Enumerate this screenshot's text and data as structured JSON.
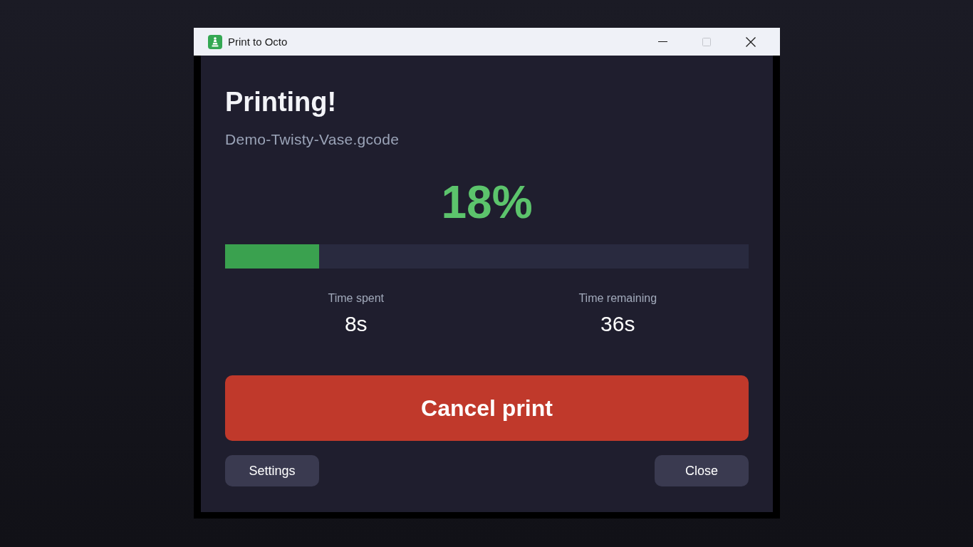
{
  "window": {
    "title": "Print to Octo",
    "controls": [
      {
        "kind": "minimize",
        "disabled": false
      },
      {
        "kind": "maximize",
        "disabled": true
      },
      {
        "kind": "close",
        "disabled": false
      }
    ]
  },
  "status": {
    "heading": "Printing!",
    "filename": "Demo-Twisty-Vase.gcode",
    "percent": "18%"
  },
  "progress": {
    "level": 0.18
  },
  "stats": [
    {
      "label": "Time spent",
      "value": "8s"
    },
    {
      "label": "Time remaining",
      "value": "36s"
    }
  ],
  "primary_button": {
    "label": "Cancel print"
  },
  "buttons": [
    {
      "label": "Settings"
    },
    {
      "label": "Close"
    }
  ]
}
